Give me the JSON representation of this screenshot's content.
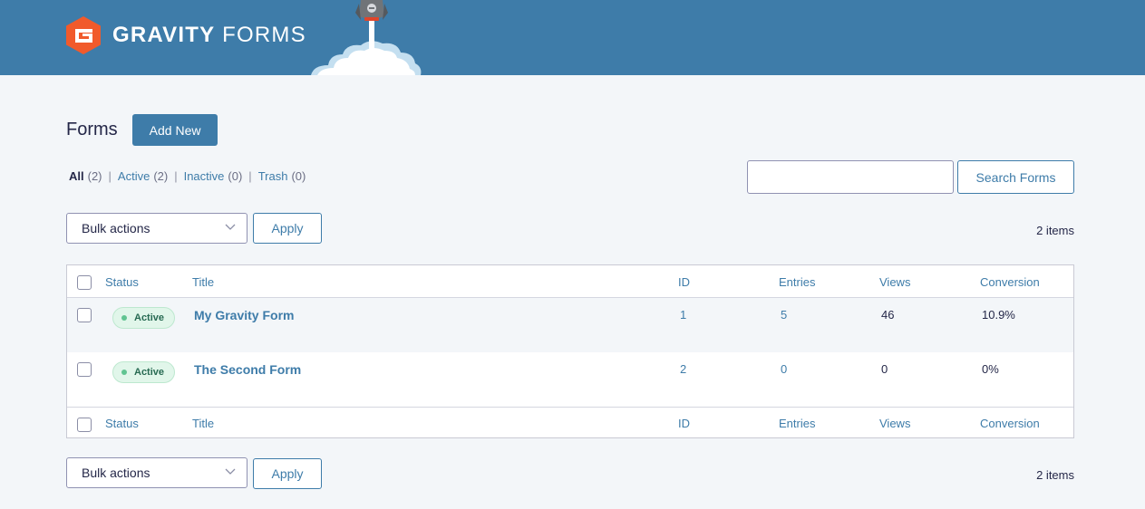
{
  "header": {
    "brand_bold": "GRAVITY",
    "brand_light": " FORMS",
    "bg_color": "#3e7ca9",
    "logo_color": "#f15a2b"
  },
  "page": {
    "title": "Forms",
    "add_new_label": "Add New"
  },
  "filters": [
    {
      "label": "All",
      "count": "(2)",
      "current": true
    },
    {
      "label": "Active",
      "count": "(2)",
      "current": false
    },
    {
      "label": "Inactive",
      "count": "(0)",
      "current": false
    },
    {
      "label": "Trash",
      "count": "(0)",
      "current": false
    }
  ],
  "search": {
    "value": "",
    "placeholder": "",
    "button_label": "Search Forms"
  },
  "bulk_top": {
    "selected": "Bulk actions",
    "apply_label": "Apply",
    "items_count": "2 items"
  },
  "bulk_bottom": {
    "selected": "Bulk actions",
    "apply_label": "Apply",
    "items_count": "2 items"
  },
  "table": {
    "columns": [
      "Status",
      "Title",
      "ID",
      "Entries",
      "Views",
      "Conversion"
    ],
    "rows": [
      {
        "status": "Active",
        "title": "My Gravity Form",
        "id": "1",
        "entries": "5",
        "views": "46",
        "conversion": "10.9%"
      },
      {
        "status": "Active",
        "title": "The Second Form",
        "id": "2",
        "entries": "0",
        "views": "0",
        "conversion": "0%"
      }
    ]
  }
}
